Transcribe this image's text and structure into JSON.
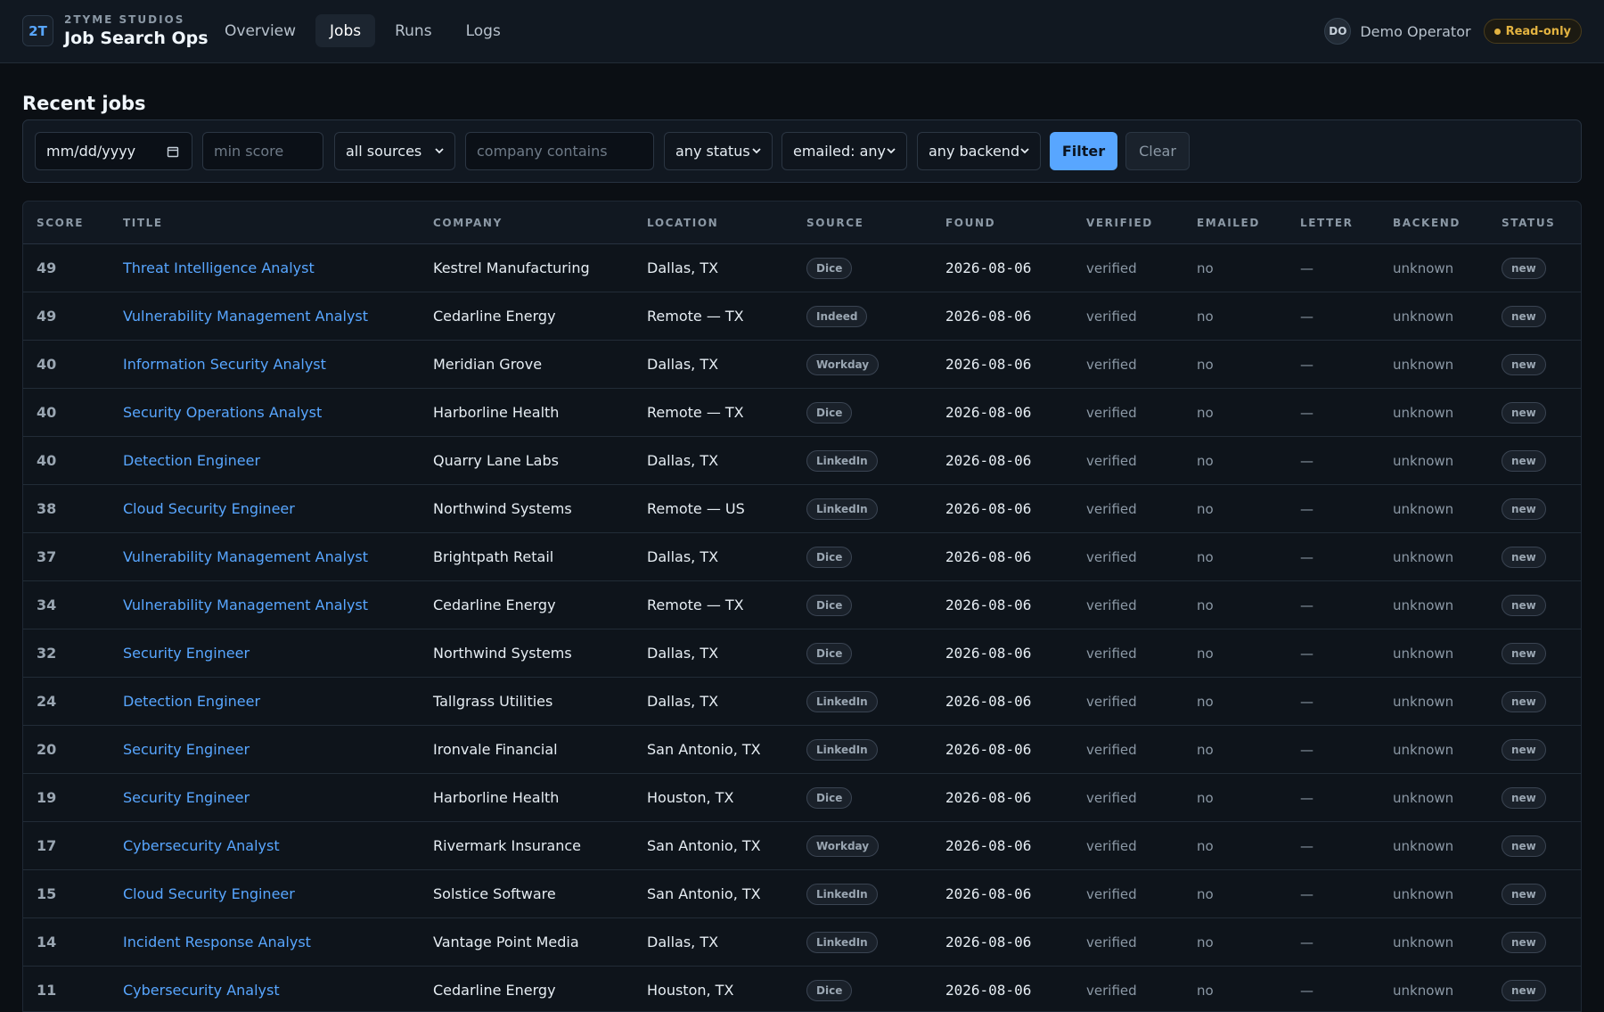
{
  "header": {
    "logo": "2T",
    "brand_sub": "2TYME STUDIOS",
    "brand_title": "Job Search Ops",
    "nav": [
      "Overview",
      "Jobs",
      "Runs",
      "Logs"
    ],
    "active_nav": "Jobs",
    "user_initials": "DO",
    "user_name": "Demo Operator",
    "mode_badge": "Read-only"
  },
  "section_title": "Recent jobs",
  "filters": {
    "date_placeholder": "mm/dd/yyyy",
    "min_score_placeholder": "min score",
    "source_selected": "all sources",
    "company_placeholder": "company contains",
    "status_selected": "any status",
    "emailed_selected": "emailed: any",
    "backend_selected": "any backend",
    "filter_label": "Filter",
    "clear_label": "Clear"
  },
  "table": {
    "columns": [
      "SCORE",
      "TITLE",
      "COMPANY",
      "LOCATION",
      "SOURCE",
      "FOUND",
      "VERIFIED",
      "EMAILED",
      "LETTER",
      "BACKEND",
      "STATUS"
    ],
    "rows": [
      {
        "score": "49",
        "title": "Threat Intelligence Analyst",
        "company": "Kestrel Manufacturing",
        "location": "Dallas, TX",
        "source": "Dice",
        "found": "2026-08-06",
        "verified": "verified",
        "emailed": "no",
        "letter": "—",
        "backend": "unknown",
        "status": "new"
      },
      {
        "score": "49",
        "title": "Vulnerability Management Analyst",
        "company": "Cedarline Energy",
        "location": "Remote — TX",
        "source": "Indeed",
        "found": "2026-08-06",
        "verified": "verified",
        "emailed": "no",
        "letter": "—",
        "backend": "unknown",
        "status": "new"
      },
      {
        "score": "40",
        "title": "Information Security Analyst",
        "company": "Meridian Grove",
        "location": "Dallas, TX",
        "source": "Workday",
        "found": "2026-08-06",
        "verified": "verified",
        "emailed": "no",
        "letter": "—",
        "backend": "unknown",
        "status": "new"
      },
      {
        "score": "40",
        "title": "Security Operations Analyst",
        "company": "Harborline Health",
        "location": "Remote — TX",
        "source": "Dice",
        "found": "2026-08-06",
        "verified": "verified",
        "emailed": "no",
        "letter": "—",
        "backend": "unknown",
        "status": "new"
      },
      {
        "score": "40",
        "title": "Detection Engineer",
        "company": "Quarry Lane Labs",
        "location": "Dallas, TX",
        "source": "LinkedIn",
        "found": "2026-08-06",
        "verified": "verified",
        "emailed": "no",
        "letter": "—",
        "backend": "unknown",
        "status": "new"
      },
      {
        "score": "38",
        "title": "Cloud Security Engineer",
        "company": "Northwind Systems",
        "location": "Remote — US",
        "source": "LinkedIn",
        "found": "2026-08-06",
        "verified": "verified",
        "emailed": "no",
        "letter": "—",
        "backend": "unknown",
        "status": "new"
      },
      {
        "score": "37",
        "title": "Vulnerability Management Analyst",
        "company": "Brightpath Retail",
        "location": "Dallas, TX",
        "source": "Dice",
        "found": "2026-08-06",
        "verified": "verified",
        "emailed": "no",
        "letter": "—",
        "backend": "unknown",
        "status": "new"
      },
      {
        "score": "34",
        "title": "Vulnerability Management Analyst",
        "company": "Cedarline Energy",
        "location": "Remote — TX",
        "source": "Dice",
        "found": "2026-08-06",
        "verified": "verified",
        "emailed": "no",
        "letter": "—",
        "backend": "unknown",
        "status": "new"
      },
      {
        "score": "32",
        "title": "Security Engineer",
        "company": "Northwind Systems",
        "location": "Dallas, TX",
        "source": "Dice",
        "found": "2026-08-06",
        "verified": "verified",
        "emailed": "no",
        "letter": "—",
        "backend": "unknown",
        "status": "new"
      },
      {
        "score": "24",
        "title": "Detection Engineer",
        "company": "Tallgrass Utilities",
        "location": "Dallas, TX",
        "source": "LinkedIn",
        "found": "2026-08-06",
        "verified": "verified",
        "emailed": "no",
        "letter": "—",
        "backend": "unknown",
        "status": "new"
      },
      {
        "score": "20",
        "title": "Security Engineer",
        "company": "Ironvale Financial",
        "location": "San Antonio, TX",
        "source": "LinkedIn",
        "found": "2026-08-06",
        "verified": "verified",
        "emailed": "no",
        "letter": "—",
        "backend": "unknown",
        "status": "new"
      },
      {
        "score": "19",
        "title": "Security Engineer",
        "company": "Harborline Health",
        "location": "Houston, TX",
        "source": "Dice",
        "found": "2026-08-06",
        "verified": "verified",
        "emailed": "no",
        "letter": "—",
        "backend": "unknown",
        "status": "new"
      },
      {
        "score": "17",
        "title": "Cybersecurity Analyst",
        "company": "Rivermark Insurance",
        "location": "San Antonio, TX",
        "source": "Workday",
        "found": "2026-08-06",
        "verified": "verified",
        "emailed": "no",
        "letter": "—",
        "backend": "unknown",
        "status": "new"
      },
      {
        "score": "15",
        "title": "Cloud Security Engineer",
        "company": "Solstice Software",
        "location": "San Antonio, TX",
        "source": "LinkedIn",
        "found": "2026-08-06",
        "verified": "verified",
        "emailed": "no",
        "letter": "—",
        "backend": "unknown",
        "status": "new"
      },
      {
        "score": "14",
        "title": "Incident Response Analyst",
        "company": "Vantage Point Media",
        "location": "Dallas, TX",
        "source": "LinkedIn",
        "found": "2026-08-06",
        "verified": "verified",
        "emailed": "no",
        "letter": "—",
        "backend": "unknown",
        "status": "new"
      },
      {
        "score": "11",
        "title": "Cybersecurity Analyst",
        "company": "Cedarline Energy",
        "location": "Houston, TX",
        "source": "Dice",
        "found": "2026-08-06",
        "verified": "verified",
        "emailed": "no",
        "letter": "—",
        "backend": "unknown",
        "status": "new"
      }
    ]
  },
  "colors": {
    "accent": "#58a6ff",
    "warning": "#e3b341",
    "background": "#0b0f14",
    "surface": "#111821"
  }
}
